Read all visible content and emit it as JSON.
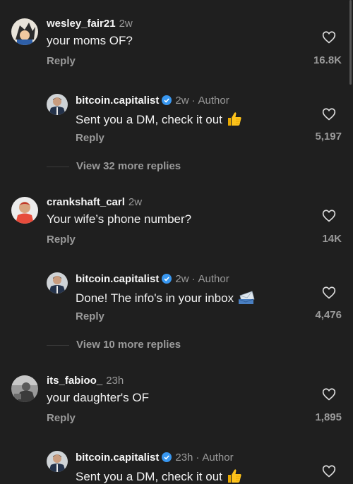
{
  "comments": [
    {
      "username": "wesley_fair21",
      "time": "2w",
      "text": "your moms OF?",
      "reply_label": "Reply",
      "likes": "16.8K",
      "reply": {
        "username": "bitcoin.capitalist",
        "time": "2w",
        "author_label": "Author",
        "text": "Sent you a DM, check it out",
        "emoji": "thumbs-up-icon",
        "reply_label": "Reply",
        "likes": "5,197"
      },
      "view_more": "View 32 more replies"
    },
    {
      "username": "crankshaft_carl",
      "time": "2w",
      "text": "Your wife’s phone number?",
      "reply_label": "Reply",
      "likes": "14K",
      "reply": {
        "username": "bitcoin.capitalist",
        "time": "2w",
        "author_label": "Author",
        "text": "Done! The info's in your inbox",
        "emoji": "envelope-icon",
        "reply_label": "Reply",
        "likes": "4,476"
      },
      "view_more": "View 10 more replies"
    },
    {
      "username": "its_fabioo_",
      "time": "23h",
      "text": "your daughter's OF",
      "reply_label": "Reply",
      "likes": "1,895",
      "reply": {
        "username": "bitcoin.capitalist",
        "time": "23h",
        "author_label": "Author",
        "text": "Sent you a DM, check it out",
        "emoji": "thumbs-up-icon"
      }
    }
  ],
  "colors": {
    "background": "#1f1f1f",
    "verified": "#3897f0",
    "muted": "#9a9a9a"
  }
}
